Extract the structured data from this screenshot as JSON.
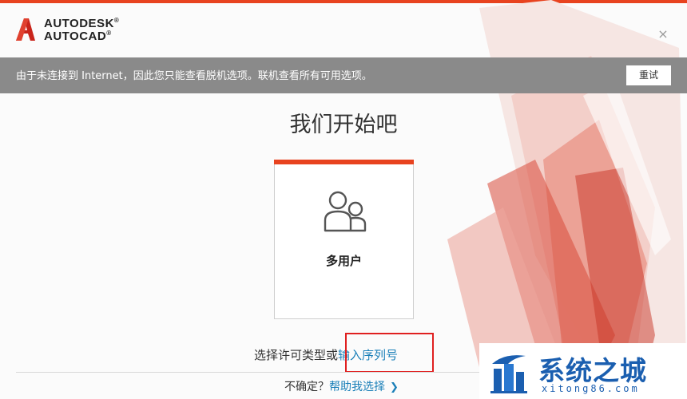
{
  "app": {
    "brand_line1": "AUTODESK",
    "brand_line2": "AUTOCAD",
    "registered_mark": "®",
    "close_symbol": "×"
  },
  "offline_bar": {
    "message": "由于未连接到 Internet，因此您只能查看脱机选项。联机查看所有可用选项。",
    "retry_label": "重试"
  },
  "main": {
    "title": "我们开始吧",
    "card": {
      "label": "多用户",
      "icon": "users-icon"
    },
    "license_prefix": "选择许可类型或",
    "serial_link": "输入序列号",
    "help_prefix": "不确定？",
    "help_link": "帮助我选择",
    "help_chevron": "❯"
  },
  "watermark": {
    "title": "系统之城",
    "subtitle": "xitong86.com"
  },
  "colors": {
    "accent": "#e8431f",
    "link": "#1a7fb8",
    "offline_bar": "#8a8a8a",
    "highlight": "#e02020",
    "watermark": "#1b5fb0"
  }
}
